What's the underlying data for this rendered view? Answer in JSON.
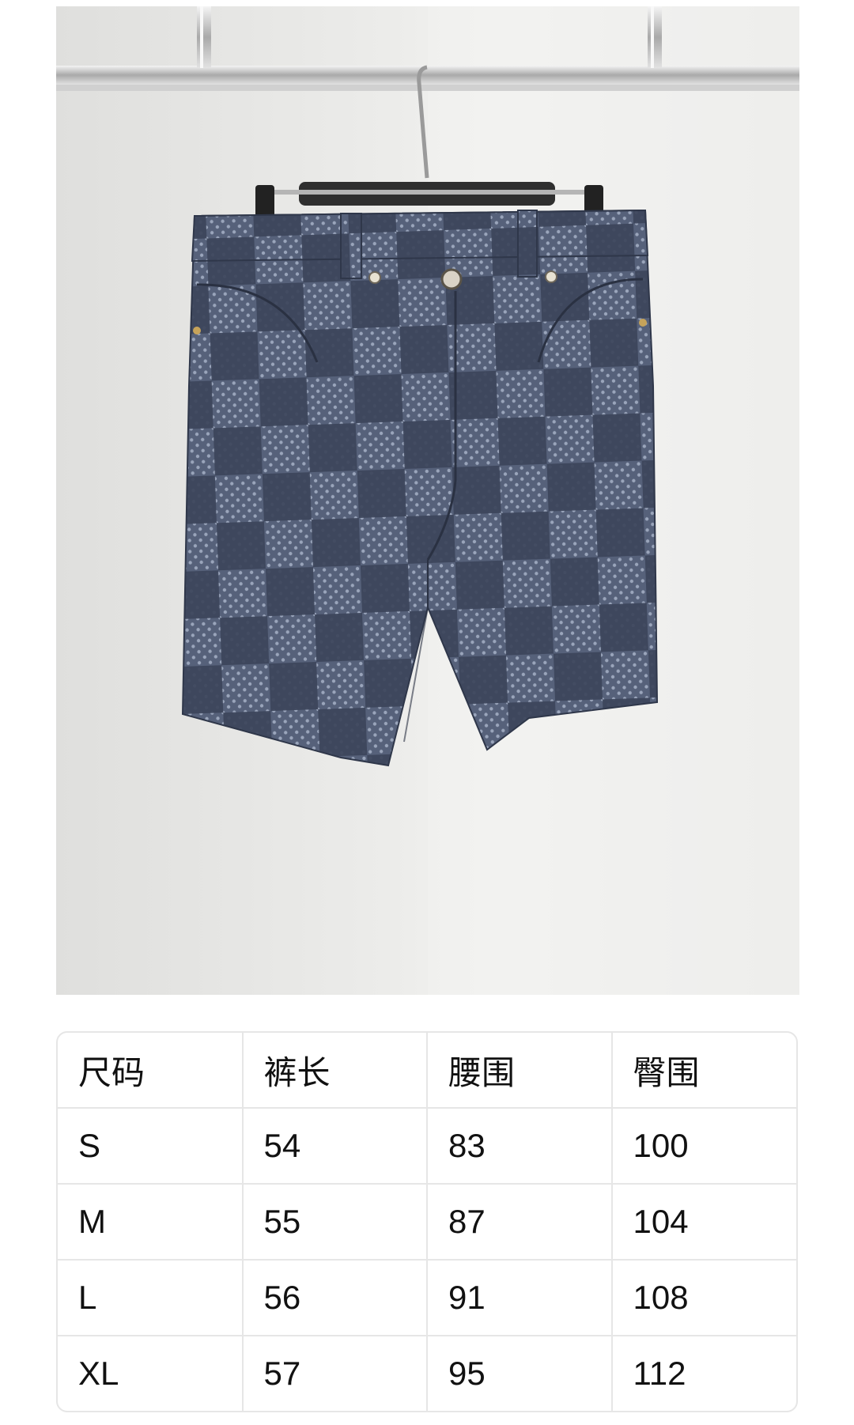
{
  "product_photo": {
    "alt": "denim checkerboard shorts on hanger"
  },
  "size_table": {
    "headers": [
      "尺码",
      "裤长",
      "腰围",
      "臀围"
    ],
    "rows": [
      [
        "S",
        "54",
        "83",
        "100"
      ],
      [
        "M",
        "55",
        "87",
        "104"
      ],
      [
        "L",
        "56",
        "91",
        "108"
      ],
      [
        "XL",
        "57",
        "95",
        "112"
      ]
    ]
  },
  "colors": {
    "denim_dark": "#3a4357",
    "denim_light": "#5c667c",
    "border": "#e6e6e6"
  }
}
